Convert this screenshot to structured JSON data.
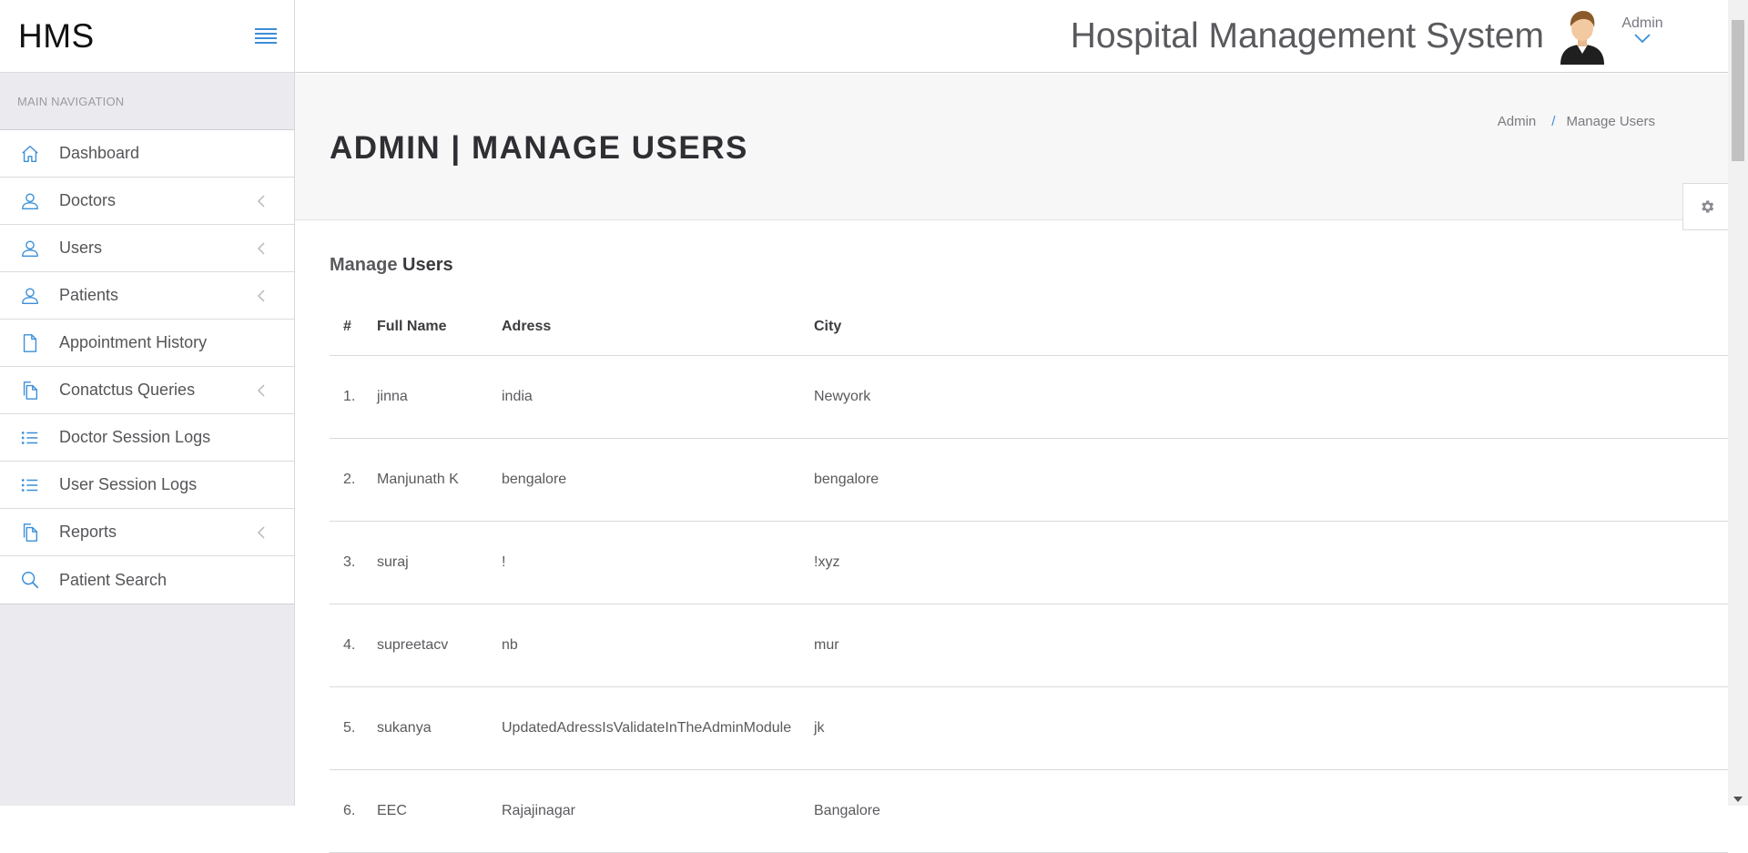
{
  "brand": "HMS",
  "app_title": "Hospital Management System",
  "user": {
    "name": "Admin"
  },
  "sidebar": {
    "header": "MAIN NAVIGATION",
    "items": [
      {
        "label": "Dashboard",
        "icon": "home-icon",
        "has_children": false
      },
      {
        "label": "Doctors",
        "icon": "user-icon",
        "has_children": true
      },
      {
        "label": "Users",
        "icon": "user-icon",
        "has_children": true
      },
      {
        "label": "Patients",
        "icon": "user-icon",
        "has_children": true
      },
      {
        "label": "Appointment History",
        "icon": "file-icon",
        "has_children": false
      },
      {
        "label": "Conatctus Queries",
        "icon": "files-icon",
        "has_children": true
      },
      {
        "label": "Doctor Session Logs",
        "icon": "list-icon",
        "has_children": false
      },
      {
        "label": "User Session Logs",
        "icon": "list-icon",
        "has_children": false
      },
      {
        "label": "Reports",
        "icon": "files-icon",
        "has_children": true
      },
      {
        "label": "Patient Search",
        "icon": "search-icon",
        "has_children": false
      }
    ]
  },
  "page": {
    "title": "ADMIN | MANAGE USERS",
    "breadcrumb": [
      "Admin",
      "/",
      "Manage Users"
    ]
  },
  "panel": {
    "title_prefix": "Manage",
    "title_bold": "Users"
  },
  "table": {
    "headers": [
      "#",
      "Full Name",
      "Adress",
      "City"
    ],
    "rows": [
      {
        "num": "1.",
        "name": "jinna",
        "address": "india",
        "city": "Newyork"
      },
      {
        "num": "2.",
        "name": "Manjunath K",
        "address": "bengalore",
        "city": "bengalore"
      },
      {
        "num": "3.",
        "name": "suraj",
        "address": "!",
        "city": "!xyz"
      },
      {
        "num": "4.",
        "name": "supreetacv",
        "address": "nb",
        "city": "mur"
      },
      {
        "num": "5.",
        "name": "sukanya",
        "address": "UpdatedAdressIsValidateInTheAdminModule",
        "city": "jk"
      },
      {
        "num": "6.",
        "name": "EEC",
        "address": "Rajajinagar",
        "city": "Bangalore"
      }
    ]
  },
  "colors": {
    "accent": "#3b8fd8",
    "sidebar_bg": "#ebebef",
    "header_bg": "#f7f7f8"
  }
}
